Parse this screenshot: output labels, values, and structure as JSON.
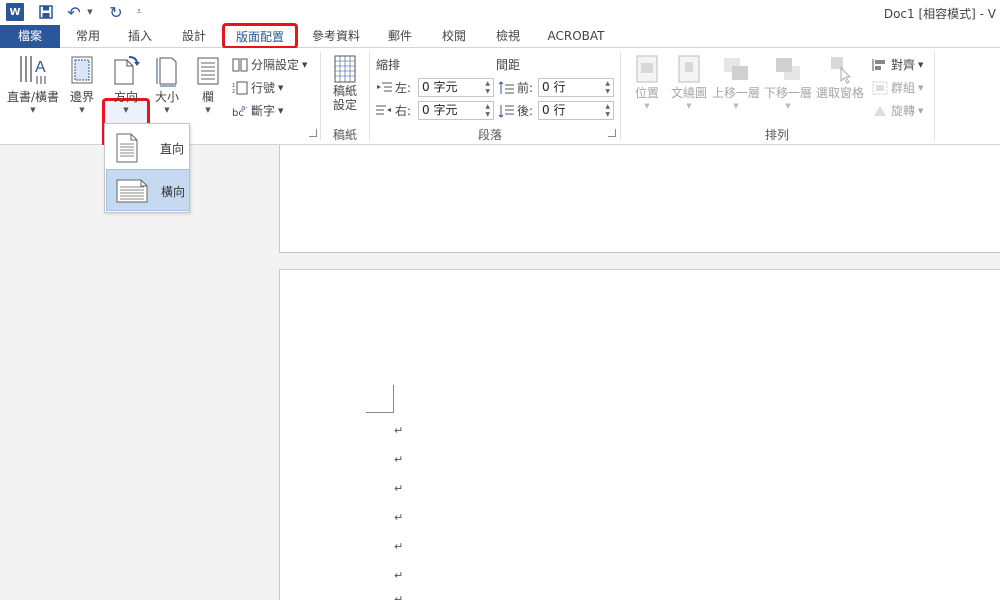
{
  "titlebar": {
    "app_badge": "W",
    "title": "Doc1 [相容模式] - V"
  },
  "tabs": [
    {
      "label": "檔案"
    },
    {
      "label": "常用"
    },
    {
      "label": "插入"
    },
    {
      "label": "設計"
    },
    {
      "label": "版面配置"
    },
    {
      "label": "參考資料"
    },
    {
      "label": "郵件"
    },
    {
      "label": "校閱"
    },
    {
      "label": "檢視"
    },
    {
      "label": "ACROBAT"
    }
  ],
  "ribbon": {
    "page_setup": {
      "text_direction": "直書/橫書",
      "margins": "邊界",
      "orientation": "方向",
      "size": "大小",
      "columns": "欄",
      "breaks": "分隔設定",
      "line_numbers": "行號",
      "hyphenation": "斷字"
    },
    "manuscript": {
      "settings_line1": "稿紙",
      "settings_line2": "設定",
      "group_label": "稿紙"
    },
    "paragraph": {
      "indent_label": "縮排",
      "spacing_label": "間距",
      "left_label": "左:",
      "right_label": "右:",
      "before_label": "前:",
      "after_label": "後:",
      "left_value": "0 字元",
      "right_value": "0 字元",
      "before_value": "0 行",
      "after_value": "0 行",
      "group_label": "段落"
    },
    "arrange": {
      "position": "位置",
      "wrap_text": "文繞圖",
      "bring_forward": "上移一層",
      "send_backward": "下移一層",
      "selection_pane": "選取窗格",
      "align": "對齊",
      "group": "群組",
      "rotate": "旋轉",
      "group_label": "排列"
    }
  },
  "orientation_menu": {
    "portrait": "直向",
    "landscape": "橫向"
  },
  "document": {
    "paragraph_mark": "↵"
  },
  "colors": {
    "accent": "#2b579a",
    "highlight_red": "#e8141b",
    "selected_bg": "#c5d9f1"
  }
}
